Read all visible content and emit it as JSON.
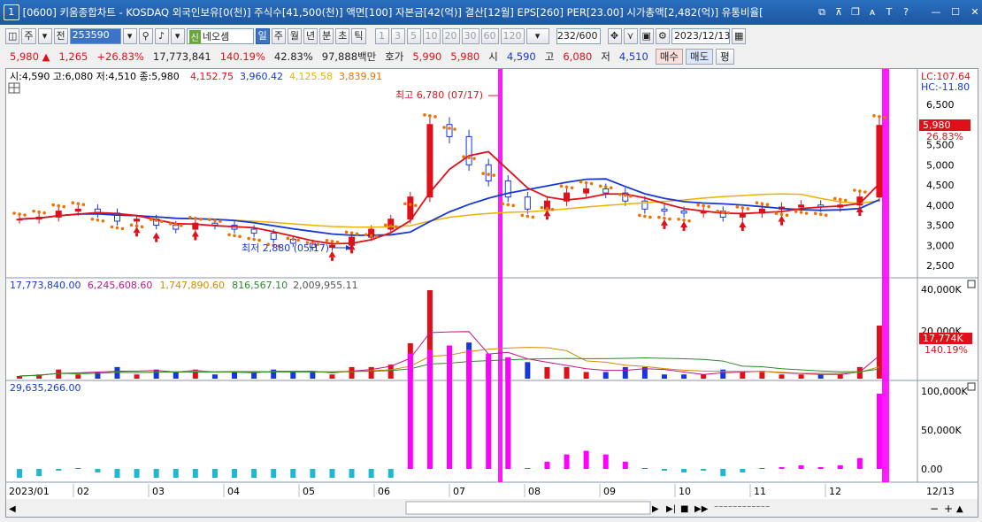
{
  "window": {
    "number": "1",
    "title": "[0600] 키움종합차트 - KOSDAQ 외국인보유[0(천)] 주식수[41,500(천)] 액면[100] 자본금[42(억)] 결산[12월] EPS[260] PER[23.00] 시가총액[2,482(억)] 유통비율["
  },
  "toolbar": {
    "period_btn": "주",
    "prev_btn": "전",
    "code": "253590",
    "stock_badge": "신",
    "stock_name": "네오셈",
    "periods": [
      "일",
      "주",
      "월",
      "년",
      "분",
      "초",
      "틱"
    ],
    "active_period": "일",
    "intervals": [
      "1",
      "3",
      "5",
      "10",
      "20",
      "30",
      "60",
      "120"
    ],
    "count": "232",
    "count_max": "/600",
    "date": "2023/12/13"
  },
  "quote": {
    "price": "5,980",
    "change": "1,265",
    "change_pct": "+26.83%",
    "volume": "17,773,841",
    "vol_ratio": "140.19%",
    "turnover": "42.83%",
    "amount": "97,888백만",
    "bid_label": "호가",
    "ask_price": "5,990",
    "bid_price": "5,980",
    "open_label": "시",
    "open": "4,590",
    "high_label": "고",
    "high": "6,080",
    "low_label": "저",
    "low": "4,510",
    "buy_btn": "매수",
    "sell_btn": "매도",
    "eval_btn": "평"
  },
  "price_panel": {
    "ohlc": "시:4,590 고:6,080 저:4,510 종:5,980",
    "ma_values": [
      {
        "text": "4,152.75",
        "color": "#e0101a"
      },
      {
        "text": "3,960.42",
        "color": "#1538d8"
      },
      {
        "text": "4,125.58",
        "color": "#f0b000"
      },
      {
        "text": "3,839.91",
        "color": "#f07000"
      }
    ],
    "lc": "LC:107.64",
    "hc": "HC:-11.80",
    "price_tag": "5,980",
    "pct_tag": "26.83%",
    "high_note": "최고 6,780 (07/17)",
    "low_note": "최저 2,880 (05/17)",
    "y_ticks": [
      "6,500",
      "6,000",
      "5,500",
      "5,000",
      "4,500",
      "4,000",
      "3,500",
      "3,000",
      "2,500"
    ]
  },
  "volume_panel": {
    "values": [
      {
        "text": "17,773,840.00",
        "color": "#1538d8"
      },
      {
        "text": "6,245,608.60",
        "color": "#c0168c"
      },
      {
        "text": "1,747,890.60",
        "color": "#d08a00"
      },
      {
        "text": "816,567.10",
        "color": "#2a8a2a"
      },
      {
        "text": "2,009,955.11",
        "color": "#555555"
      }
    ],
    "y_ticks": [
      "40,000K",
      "20,000K"
    ],
    "vol_tag": "17,774K",
    "pct_tag": "140.19%"
  },
  "indicator_panel": {
    "value": "29,635,266.00",
    "y_ticks": [
      "100,000K",
      "50,000K",
      "0.00"
    ]
  },
  "x_axis": {
    "labels": [
      "2023/01",
      "02",
      "03",
      "04",
      "05",
      "06",
      "07",
      "08",
      "09",
      "10",
      "11",
      "12",
      "12/13"
    ]
  },
  "chart_data": {
    "type": "candlestick",
    "title": "네오셈 (253590) 일봉",
    "x_range": [
      "2023/01",
      "2023/12/13"
    ],
    "price_range": [
      2500,
      6780
    ],
    "series": [
      {
        "name": "close",
        "values": [
          3650,
          3700,
          3850,
          3900,
          3800,
          3600,
          3650,
          3500,
          3400,
          3550,
          3500,
          3400,
          3300,
          3150,
          3050,
          2950,
          3000,
          3200,
          3400,
          3650,
          4200,
          6000,
          5700,
          5000,
          4600,
          4200,
          3900,
          4100,
          4300,
          4400,
          4300,
          4100,
          3900,
          3850,
          3800,
          3850,
          3700,
          3800,
          3900,
          3950,
          4000,
          3950,
          4000,
          4200,
          5980
        ]
      }
    ],
    "annotations": [
      "최고 6,780 (07/17)",
      "최저 2,880 (05/17)"
    ],
    "grid": false,
    "colors": {
      "up": "#e0101a",
      "down": "#1538d8",
      "highlight": "#ff00ff"
    }
  }
}
